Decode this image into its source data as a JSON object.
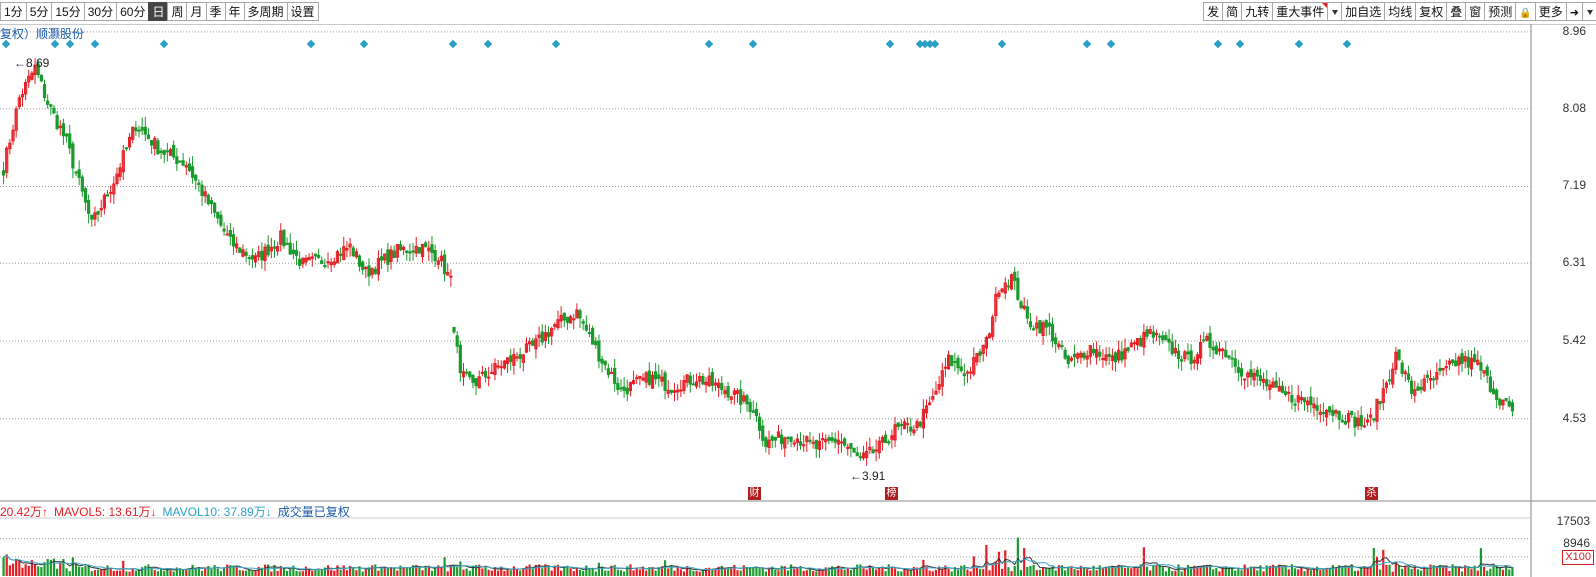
{
  "toolbar": {
    "left": [
      {
        "label": "1分",
        "active": false
      },
      {
        "label": "5分",
        "active": false
      },
      {
        "label": "15分",
        "active": false
      },
      {
        "label": "30分",
        "active": false
      },
      {
        "label": "60分",
        "active": false
      },
      {
        "label": "日",
        "active": true
      },
      {
        "label": "周",
        "active": false
      },
      {
        "label": "月",
        "active": false
      },
      {
        "label": "季",
        "active": false
      },
      {
        "label": "年",
        "active": false
      },
      {
        "label": "多周期",
        "active": false
      },
      {
        "label": "设置",
        "active": false
      }
    ],
    "right": [
      {
        "label": "发",
        "icon": ""
      },
      {
        "label": "简",
        "icon": ""
      },
      {
        "label": "九转",
        "icon": ""
      },
      {
        "label": "重大事件",
        "icon": "red-corner"
      },
      {
        "label": "",
        "icon": "caret-down-icon"
      },
      {
        "label": "加自选",
        "icon": ""
      },
      {
        "label": "均线",
        "icon": ""
      },
      {
        "label": "复权",
        "icon": ""
      },
      {
        "label": "叠",
        "icon": ""
      },
      {
        "label": "窗",
        "icon": ""
      },
      {
        "label": "预测",
        "icon": ""
      },
      {
        "label": "",
        "icon": "lock-icon"
      },
      {
        "label": "更多",
        "icon": ""
      },
      {
        "label": "",
        "icon": "pin-icon"
      },
      {
        "label": "",
        "icon": "caret-down-icon"
      }
    ]
  },
  "stock_title": "复权）顺灏股份",
  "price_axis": [
    "8.96",
    "8.08",
    "7.19",
    "6.31",
    "5.42",
    "4.53"
  ],
  "volume_axis": [
    "17503",
    "8946"
  ],
  "zoom_label": "X100",
  "annotations": {
    "high": "8.69",
    "low": "3.91"
  },
  "event_markers": [
    "财",
    "榜",
    "杀"
  ],
  "volume_legend": {
    "vol": "20.42万↑",
    "mavol5": "MAVOL5: 13.61万↓",
    "mavol10": "MAVOL10: 37.89万↓",
    "note": "成交量已复权"
  },
  "colors": {
    "up": "#e51c23",
    "down": "#1a9a2b",
    "grid": "#9a9a9a",
    "ma5": "#333333",
    "ma10": "#3aa6c8",
    "diamond": "#2aa0c8"
  },
  "chart_data": {
    "type": "candlestick",
    "ylim": [
      3.6,
      9.05
    ],
    "highest": 8.69,
    "lowest": 3.91,
    "anchors": [
      [
        0,
        7.4
      ],
      [
        5,
        8.2
      ],
      [
        10,
        8.55
      ],
      [
        14,
        8.15
      ],
      [
        20,
        7.7
      ],
      [
        28,
        6.75
      ],
      [
        35,
        7.25
      ],
      [
        42,
        7.9
      ],
      [
        50,
        7.6
      ],
      [
        58,
        7.45
      ],
      [
        65,
        7.0
      ],
      [
        72,
        6.55
      ],
      [
        80,
        6.35
      ],
      [
        88,
        6.6
      ],
      [
        95,
        6.3
      ],
      [
        102,
        6.35
      ],
      [
        110,
        6.5
      ],
      [
        115,
        6.2
      ],
      [
        125,
        6.45
      ],
      [
        132,
        6.5
      ],
      [
        138,
        6.4
      ],
      [
        142,
        6.1
      ],
      [
        143,
        5.6
      ],
      [
        145,
        5.0
      ],
      [
        150,
        4.95
      ],
      [
        158,
        5.15
      ],
      [
        168,
        5.35
      ],
      [
        175,
        5.6
      ],
      [
        182,
        5.75
      ],
      [
        190,
        5.2
      ],
      [
        196,
        4.85
      ],
      [
        205,
        5.0
      ],
      [
        212,
        4.9
      ],
      [
        220,
        5.0
      ],
      [
        230,
        4.85
      ],
      [
        238,
        4.65
      ],
      [
        242,
        4.25
      ],
      [
        250,
        4.35
      ],
      [
        258,
        4.2
      ],
      [
        265,
        4.3
      ],
      [
        272,
        4.05
      ],
      [
        278,
        4.2
      ],
      [
        283,
        4.4
      ],
      [
        290,
        4.45
      ],
      [
        295,
        4.75
      ],
      [
        300,
        5.2
      ],
      [
        306,
        5.05
      ],
      [
        312,
        5.4
      ],
      [
        316,
        6.05
      ],
      [
        320,
        6.15
      ],
      [
        325,
        5.65
      ],
      [
        332,
        5.55
      ],
      [
        338,
        5.15
      ],
      [
        345,
        5.35
      ],
      [
        352,
        5.2
      ],
      [
        358,
        5.35
      ],
      [
        364,
        5.5
      ],
      [
        370,
        5.35
      ],
      [
        376,
        5.2
      ],
      [
        382,
        5.4
      ],
      [
        388,
        5.3
      ],
      [
        394,
        5.05
      ],
      [
        400,
        4.95
      ],
      [
        406,
        4.8
      ],
      [
        412,
        4.75
      ],
      [
        420,
        4.65
      ],
      [
        426,
        4.55
      ],
      [
        433,
        4.45
      ],
      [
        437,
        4.75
      ],
      [
        442,
        5.25
      ],
      [
        447,
        4.85
      ],
      [
        455,
        5.0
      ],
      [
        462,
        5.2
      ],
      [
        468,
        5.15
      ],
      [
        474,
        4.8
      ],
      [
        479,
        4.62
      ]
    ],
    "volume_ylim": [
      0,
      22000
    ]
  }
}
